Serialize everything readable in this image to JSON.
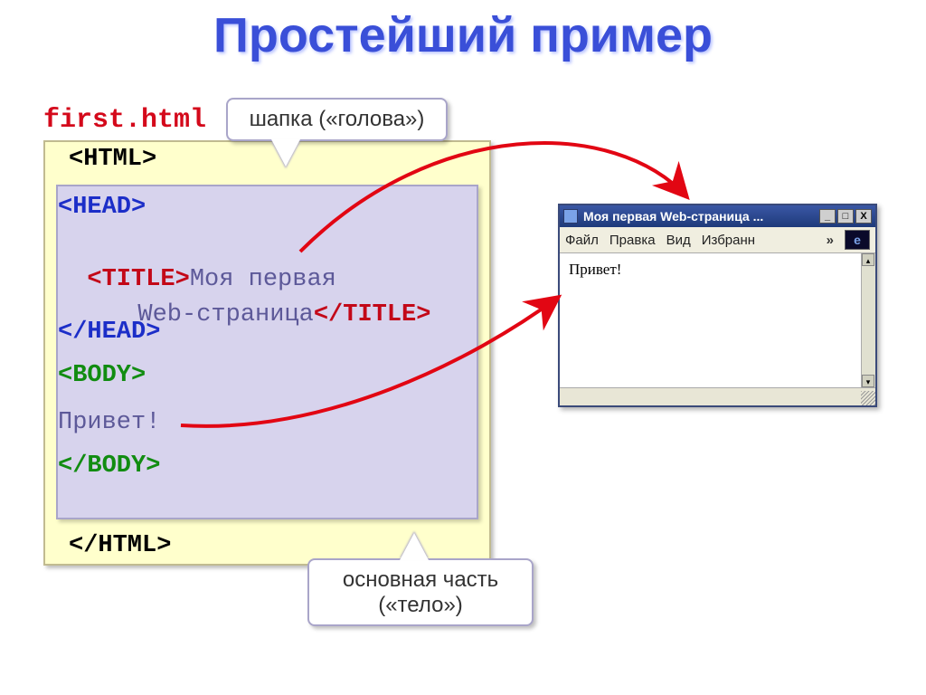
{
  "title": "Простейший пример",
  "filename": "first.html",
  "code": {
    "html_open": "<HTML>",
    "head_open": "<HEAD>",
    "title_open": "<TITLE>",
    "title_text_line1": "Моя первая",
    "title_text_line2": "Web-страница",
    "title_close": "</TITLE>",
    "head_close": "</HEAD>",
    "body_open": "<BODY>",
    "body_text": "Привет!",
    "body_close": "</BODY>",
    "html_close": "</HTML>"
  },
  "callouts": {
    "head": "шапка («голова»)",
    "body_line1": "основная часть",
    "body_line2": "(«тело»)"
  },
  "browser": {
    "title": "Моя первая Web-страница ...",
    "menu": {
      "file": "Файл",
      "edit": "Правка",
      "view": "Вид",
      "fav": "Избранн"
    },
    "content": "Привет!",
    "window_controls": {
      "min": "_",
      "max": "□",
      "close": "X"
    },
    "chevrons": "»",
    "ie_glyph": "e",
    "scroll_up": "▴",
    "scroll_down": "▾"
  }
}
